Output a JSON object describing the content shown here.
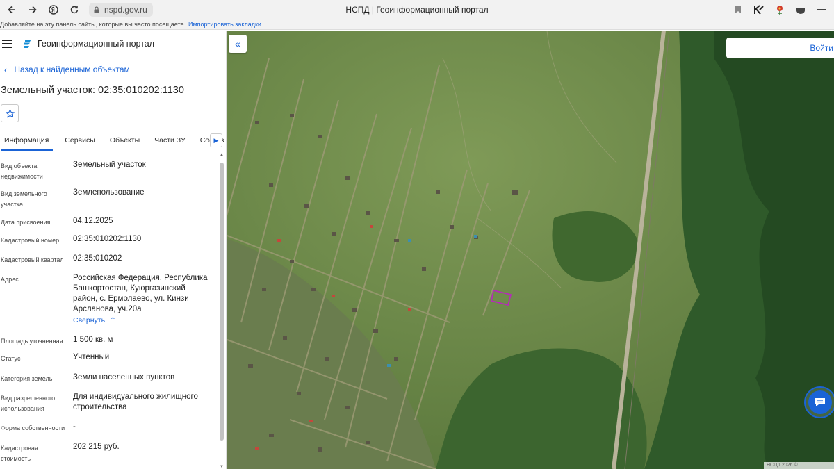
{
  "browser": {
    "url": "nspd.gov.ru",
    "tab_title": "НСПД | Геоинформационный портал",
    "bookmarks_hint": "Добавляйте на эту панель сайты, которые вы часто посещаете.",
    "bookmarks_link": "Импортировать закладки"
  },
  "panel": {
    "portal_title": "Геоинформационный портал",
    "back_label": "Назад к найденным объектам",
    "object_title": "Земельный участок: 02:35:010202:1130",
    "tabs": [
      "Информация",
      "Сервисы",
      "Объекты",
      "Части ЗУ",
      "Состав"
    ],
    "active_tab": "Информация",
    "collapse_link": "Свернуть",
    "properties": [
      {
        "label": "Вид объекта недвижимости",
        "value": "Земельный участок"
      },
      {
        "label": "Вид земельного участка",
        "value": "Землепользование"
      },
      {
        "label": "Дата присвоения",
        "value": "04.12.2025"
      },
      {
        "label": "Кадастровый номер",
        "value": "02:35:010202:1130"
      },
      {
        "label": "Кадастровый квартал",
        "value": "02:35:010202"
      },
      {
        "label": "Адрес",
        "value": "Российская Федерация, Республика Башкортостан, Куюргазинский район, с. Ермолаево, ул. Кинзи Арсланова, уч.20а"
      },
      {
        "label": "Площадь уточненная",
        "value": "1 500 кв. м"
      },
      {
        "label": "Статус",
        "value": "Учтенный"
      },
      {
        "label": "Категория земель",
        "value": "Земли населенных пунктов"
      },
      {
        "label": "Вид разрешенного использования",
        "value": "Для индивидуального жилищного строительства"
      },
      {
        "label": "Форма собственности",
        "value": "-"
      },
      {
        "label": "Кадастровая стоимость",
        "value": "202 215 руб."
      }
    ]
  },
  "map": {
    "login_label": "Войти",
    "copyright": "НСПД 2026 ©",
    "highlight_color": "#b52bb8"
  }
}
